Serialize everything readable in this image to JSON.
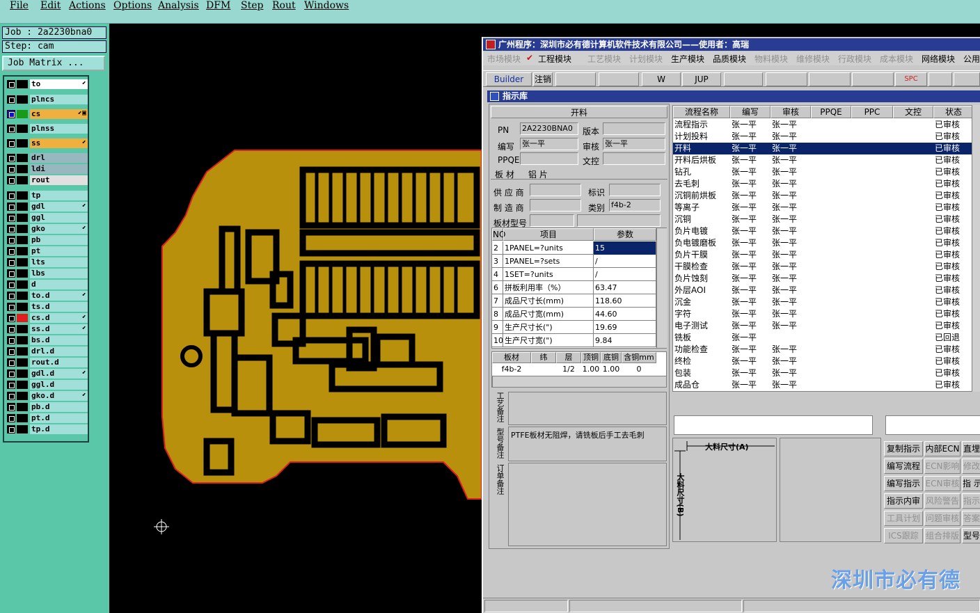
{
  "menu": [
    "File",
    "Edit",
    "Actions",
    "Options",
    "Analysis",
    "DFM",
    "Step",
    "Rout",
    "Windows"
  ],
  "job": {
    "job_line": "Job : 2a2230bna0",
    "step_line": "Step: cam",
    "matrix_button": "Job Matrix ..."
  },
  "layers": [
    {
      "name": "to",
      "color": "#000000",
      "bg": "#ffffff",
      "flag": "⬋"
    },
    {
      "name": "plncs",
      "color": "#000000",
      "bg": "#a0e0d8",
      "flag": ""
    },
    {
      "name": "cs",
      "color": "#1a9a1a",
      "bg": "#f0b040",
      "flag": "⬋▣",
      "active": true
    },
    {
      "name": "plnss",
      "color": "#000000",
      "bg": "#a0e0d8",
      "flag": ""
    },
    {
      "name": "ss",
      "color": "#000000",
      "bg": "#f0b040",
      "flag": "⬋"
    },
    {
      "name": "drl",
      "color": "#000000",
      "bg": "#98b8c0",
      "flag": ""
    },
    {
      "name": "ldi",
      "color": "#000000",
      "bg": "#98b8c0",
      "flag": ""
    },
    {
      "name": "rout",
      "color": "#000000",
      "bg": "#e0e0e0",
      "flag": ""
    },
    {
      "name": "tp",
      "color": "#000000",
      "bg": "#a0e0d8",
      "flag": ""
    },
    {
      "name": "gdl",
      "color": "#000000",
      "bg": "#a0e0d8",
      "flag": "⬋"
    },
    {
      "name": "ggl",
      "color": "#000000",
      "bg": "#a0e0d8",
      "flag": ""
    },
    {
      "name": "gko",
      "color": "#000000",
      "bg": "#a0e0d8",
      "flag": "⬋"
    },
    {
      "name": "pb",
      "color": "#000000",
      "bg": "#a0e0d8",
      "flag": ""
    },
    {
      "name": "pt",
      "color": "#000000",
      "bg": "#a0e0d8",
      "flag": ""
    },
    {
      "name": "lts",
      "color": "#000000",
      "bg": "#a0e0d8",
      "flag": ""
    },
    {
      "name": "lbs",
      "color": "#000000",
      "bg": "#a0e0d8",
      "flag": ""
    },
    {
      "name": "d",
      "color": "#000000",
      "bg": "#a0e0d8",
      "flag": ""
    },
    {
      "name": "to.d",
      "color": "#000000",
      "bg": "#a0e0d8",
      "flag": "⬋"
    },
    {
      "name": "ts.d",
      "color": "#000000",
      "bg": "#a0e0d8",
      "flag": ""
    },
    {
      "name": "cs.d",
      "color": "#e02020",
      "bg": "#a0e0d8",
      "flag": "⬋"
    },
    {
      "name": "ss.d",
      "color": "#000000",
      "bg": "#a0e0d8",
      "flag": "⬋"
    },
    {
      "name": "bs.d",
      "color": "#000000",
      "bg": "#a0e0d8",
      "flag": ""
    },
    {
      "name": "drl.d",
      "color": "#000000",
      "bg": "#a0e0d8",
      "flag": ""
    },
    {
      "name": "rout.d",
      "color": "#000000",
      "bg": "#a0e0d8",
      "flag": ""
    },
    {
      "name": "gdl.d",
      "color": "#000000",
      "bg": "#a0e0d8",
      "flag": "⬋"
    },
    {
      "name": "ggl.d",
      "color": "#000000",
      "bg": "#a0e0d8",
      "flag": ""
    },
    {
      "name": "gko.d",
      "color": "#000000",
      "bg": "#a0e0d8",
      "flag": "⬋"
    },
    {
      "name": "pb.d",
      "color": "#000000",
      "bg": "#a0e0d8",
      "flag": ""
    },
    {
      "name": "pt.d",
      "color": "#000000",
      "bg": "#a0e0d8",
      "flag": ""
    },
    {
      "name": "tp.d",
      "color": "#000000",
      "bg": "#a0e0d8",
      "flag": ""
    }
  ],
  "erp": {
    "title": "广州程序：深圳市必有德计算机软件技术有限公司——使用者：高瑞",
    "modules": [
      {
        "label": "市场模块",
        "active": false
      },
      {
        "label": "工程模块",
        "active": true
      },
      {
        "label": "工艺模块",
        "active": false
      },
      {
        "label": "计划模块",
        "active": false
      },
      {
        "label": "生产模块",
        "active": true
      },
      {
        "label": "品质模块",
        "active": true
      },
      {
        "label": "物料模块",
        "active": false
      },
      {
        "label": "维修模块",
        "active": false
      },
      {
        "label": "行政模块",
        "active": false
      },
      {
        "label": "成本模块",
        "active": false
      },
      {
        "label": "网络模块",
        "active": true
      },
      {
        "label": "公用",
        "active": true
      }
    ],
    "toolbar": [
      "Builder",
      "注销",
      "",
      "",
      "W",
      "JUP",
      "",
      "",
      "",
      "",
      "SPC",
      "",
      ""
    ],
    "sub_title": "指示库",
    "form": {
      "section": "开料",
      "pn_label": "PN",
      "pn": "2A2230BNA0",
      "version_label": "版本",
      "version": "",
      "author_label": "编写",
      "author": "张一平",
      "review_label": "审核",
      "review": "张一平",
      "ppqe_label": "PPQE",
      "ppqe": "",
      "doc_label": "文控",
      "doc": "",
      "tabs": [
        "板 材",
        "铝 片"
      ],
      "supplier_label": "供 应 商",
      "supplier": "",
      "mark_label": "标识",
      "mark": "",
      "maker_label": "制 造 商",
      "maker": "",
      "type_label": "类别",
      "type": "f4b-2",
      "model_label": "板材型号",
      "model": ""
    },
    "params_header": [
      "NO",
      "项目",
      "参数"
    ],
    "params": [
      [
        "2",
        "1PANEL=?units",
        "15"
      ],
      [
        "3",
        "1PANEL=?sets",
        "/"
      ],
      [
        "4",
        "1SET=?units",
        "/"
      ],
      [
        "6",
        "拼板利用率（%）",
        "63.47"
      ],
      [
        "7",
        "成品尺寸长(mm)",
        "118.60"
      ],
      [
        "8",
        "成品尺寸宽(mm)",
        "44.60"
      ],
      [
        "9",
        "生产尺寸长(\")",
        "19.69"
      ],
      [
        "10",
        "生产尺寸宽(\")",
        "9.84"
      ]
    ],
    "board_header": [
      "板材",
      "纬",
      "层",
      "顶铜",
      "底铜",
      "含铜mm"
    ],
    "board_row": [
      "f4b-2",
      "",
      "1/2",
      "1.00",
      "1.00",
      "0"
    ],
    "note_labels": [
      "工艺备注",
      "型号备注",
      "订单备注"
    ],
    "note_text": "PTFE板材无阻焊，请铣板后手工去毛刺",
    "flow_header": [
      "流程名称",
      "编写",
      "审核",
      "PPQE",
      "PPC",
      "文控",
      "状态"
    ],
    "flows": [
      [
        "流程指示",
        "张一平",
        "张一平",
        "",
        "",
        "",
        "已审核"
      ],
      [
        "计划投料",
        "张一平",
        "张一平",
        "",
        "",
        "",
        "已审核"
      ],
      [
        "开料",
        "张一平",
        "张一平",
        "",
        "",
        "",
        "已审核"
      ],
      [
        "开料后烘板",
        "张一平",
        "张一平",
        "",
        "",
        "",
        "已审核"
      ],
      [
        "钻孔",
        "张一平",
        "张一平",
        "",
        "",
        "",
        "已审核"
      ],
      [
        "去毛刺",
        "张一平",
        "张一平",
        "",
        "",
        "",
        "已审核"
      ],
      [
        "沉铜前烘板",
        "张一平",
        "张一平",
        "",
        "",
        "",
        "已审核"
      ],
      [
        "等离子",
        "张一平",
        "张一平",
        "",
        "",
        "",
        "已审核"
      ],
      [
        "沉铜",
        "张一平",
        "张一平",
        "",
        "",
        "",
        "已审核"
      ],
      [
        "负片电镀",
        "张一平",
        "张一平",
        "",
        "",
        "",
        "已审核"
      ],
      [
        "负电镀磨板",
        "张一平",
        "张一平",
        "",
        "",
        "",
        "已审核"
      ],
      [
        "负片干膜",
        "张一平",
        "张一平",
        "",
        "",
        "",
        "已审核"
      ],
      [
        "干膜检查",
        "张一平",
        "张一平",
        "",
        "",
        "",
        "已审核"
      ],
      [
        "负片蚀刻",
        "张一平",
        "张一平",
        "",
        "",
        "",
        "已审核"
      ],
      [
        "外层AOI",
        "张一平",
        "张一平",
        "",
        "",
        "",
        "已审核"
      ],
      [
        "沉金",
        "张一平",
        "张一平",
        "",
        "",
        "",
        "已审核"
      ],
      [
        "字符",
        "张一平",
        "张一平",
        "",
        "",
        "",
        "已审核"
      ],
      [
        "电子测试",
        "张一平",
        "张一平",
        "",
        "",
        "",
        "已审核"
      ],
      [
        "铣板",
        "张一平",
        "",
        "",
        "",
        "",
        "已回退"
      ],
      [
        "功能检查",
        "张一平",
        "张一平",
        "",
        "",
        "",
        "已审核"
      ],
      [
        "终检",
        "张一平",
        "张一平",
        "",
        "",
        "",
        "已审核"
      ],
      [
        "包装",
        "张一平",
        "张一平",
        "",
        "",
        "",
        "已审核"
      ],
      [
        "成品仓",
        "张一平",
        "张一平",
        "",
        "",
        "",
        "已审核"
      ]
    ],
    "selected_flow": 2,
    "dim_a": "大料尺寸(A)",
    "dim_b": "大料尺寸(B)",
    "buttons": [
      [
        {
          "label": "复制指示",
          "en": true
        },
        {
          "label": "内部ECN",
          "en": true
        },
        {
          "label": "直埋",
          "en": true
        }
      ],
      [
        {
          "label": "编写流程",
          "en": true
        },
        {
          "label": "ECN影响",
          "en": false
        },
        {
          "label": "修改",
          "en": false
        }
      ],
      [
        {
          "label": "编写指示",
          "en": true
        },
        {
          "label": "ECN审核",
          "en": false
        },
        {
          "label": "指 示",
          "en": true
        }
      ],
      [
        {
          "label": "指示内审",
          "en": true
        },
        {
          "label": "风险警告",
          "en": false
        },
        {
          "label": "指示",
          "en": false
        }
      ],
      [
        {
          "label": "工具计划",
          "en": false
        },
        {
          "label": "问题审核",
          "en": false
        },
        {
          "label": "答案",
          "en": false
        }
      ],
      [
        {
          "label": "ICS跟踪",
          "en": false
        },
        {
          "label": "组合排版",
          "en": false
        },
        {
          "label": "型号",
          "en": true
        }
      ]
    ],
    "brand": "深圳市必有德"
  }
}
